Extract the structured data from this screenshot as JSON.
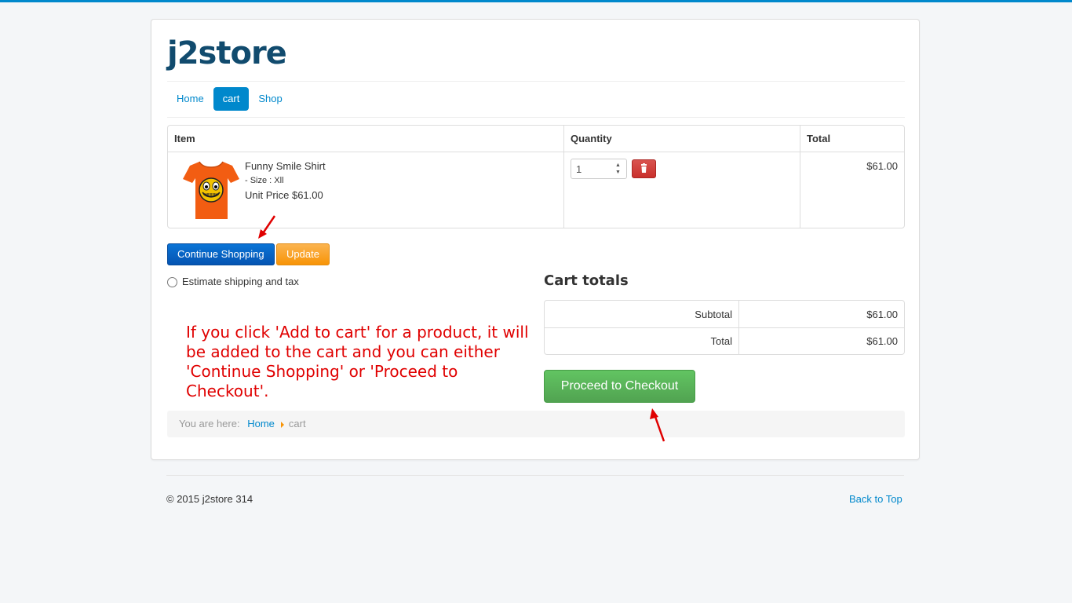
{
  "site": {
    "brand": "j2store"
  },
  "nav": {
    "items": [
      "Home",
      "cart",
      "Shop"
    ],
    "active": "cart"
  },
  "cart_table": {
    "headers": {
      "item": "Item",
      "quantity": "Quantity",
      "total": "Total"
    },
    "rows": [
      {
        "name": "Funny Smile Shirt",
        "option": "- Size : Xll",
        "unit_price": "Unit Price $61.00",
        "quantity": "1",
        "total": "$61.00"
      }
    ]
  },
  "buttons": {
    "continue": "Continue Shopping",
    "update": "Update",
    "checkout": "Proceed to Checkout"
  },
  "estimate": {
    "label": "Estimate shipping and tax"
  },
  "annotation": {
    "note": "If you click 'Add to cart' for a product, it will be added to the cart and you can either 'Continue Shopping' or 'Proceed to Checkout'."
  },
  "totals": {
    "title": "Cart totals",
    "rows": [
      {
        "label": "Subtotal",
        "value": "$61.00"
      },
      {
        "label": "Total",
        "value": "$61.00"
      }
    ]
  },
  "breadcrumb": {
    "prefix": "You are here:",
    "home": "Home",
    "current": "cart"
  },
  "footer": {
    "copyright": "© 2015 j2store 314",
    "back_to_top": "Back to Top"
  },
  "colors": {
    "accent": "#0088cc",
    "brand": "#114b6e",
    "annotation": "#e00000",
    "success": "#51a351",
    "warning": "#f89406",
    "danger": "#c9302c"
  },
  "icons": [
    "trash-icon",
    "tshirt-product-image",
    "annotation-arrow"
  ]
}
